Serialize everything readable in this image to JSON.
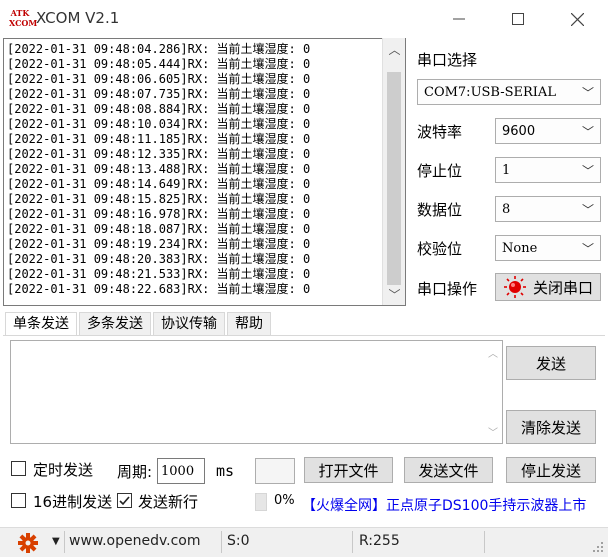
{
  "window": {
    "logo_line1": "ATK",
    "logo_line2": "XCOM",
    "title": "XCOM V2.1"
  },
  "receive": {
    "lines": [
      "[2022-01-31 09:48:04.286]RX: 当前土壤湿度: 0",
      "[2022-01-31 09:48:05.444]RX: 当前土壤湿度: 0",
      "[2022-01-31 09:48:06.605]RX: 当前土壤湿度: 0",
      "[2022-01-31 09:48:07.735]RX: 当前土壤湿度: 0",
      "[2022-01-31 09:48:08.884]RX: 当前土壤湿度: 0",
      "[2022-01-31 09:48:10.034]RX: 当前土壤湿度: 0",
      "[2022-01-31 09:48:11.185]RX: 当前土壤湿度: 0",
      "[2022-01-31 09:48:12.335]RX: 当前土壤湿度: 0",
      "[2022-01-31 09:48:13.488]RX: 当前土壤湿度: 0",
      "[2022-01-31 09:48:14.649]RX: 当前土壤湿度: 0",
      "[2022-01-31 09:48:15.825]RX: 当前土壤湿度: 0",
      "[2022-01-31 09:48:16.978]RX: 当前土壤湿度: 0",
      "[2022-01-31 09:48:18.087]RX: 当前土壤湿度: 0",
      "[2022-01-31 09:48:19.234]RX: 当前土壤湿度: 0",
      "[2022-01-31 09:48:20.383]RX: 当前土壤湿度: 0",
      "[2022-01-31 09:48:21.533]RX: 当前土壤湿度: 0",
      "[2022-01-31 09:48:22.683]RX: 当前土壤湿度: 0"
    ]
  },
  "settings": {
    "port_select_label": "串口选择",
    "port_value": "COM7:USB-SERIAL",
    "baud_label": "波特率",
    "baud_value": "9600",
    "stop_label": "停止位",
    "stop_value": "1",
    "data_label": "数据位",
    "data_value": "8",
    "parity_label": "校验位",
    "parity_value": "None",
    "port_op_label": "串口操作",
    "close_port_button": "关闭串口"
  },
  "tabs": [
    "单条发送",
    "多条发送",
    "协议传输",
    "帮助"
  ],
  "send": {
    "send_button": "发送",
    "clear_button": "清除发送",
    "timed_send_label": "定时发送",
    "period_label": "周期:",
    "period_value": "1000",
    "period_unit": "ms",
    "open_file_button": "打开文件",
    "send_file_button": "发送文件",
    "stop_send_button": "停止发送",
    "hex_send_label": "16进制发送",
    "newline_label": "发送新行",
    "newline_checked": true,
    "progress_text": "0%",
    "progress": 0,
    "ad_text": "【火爆全网】正点原子DS100手持示波器上市"
  },
  "status": {
    "url": "www.openedv.com",
    "sent": "S:0",
    "received": "R:255"
  },
  "colors": {
    "accent_red": "#d40000",
    "link_blue": "#0000ee"
  }
}
